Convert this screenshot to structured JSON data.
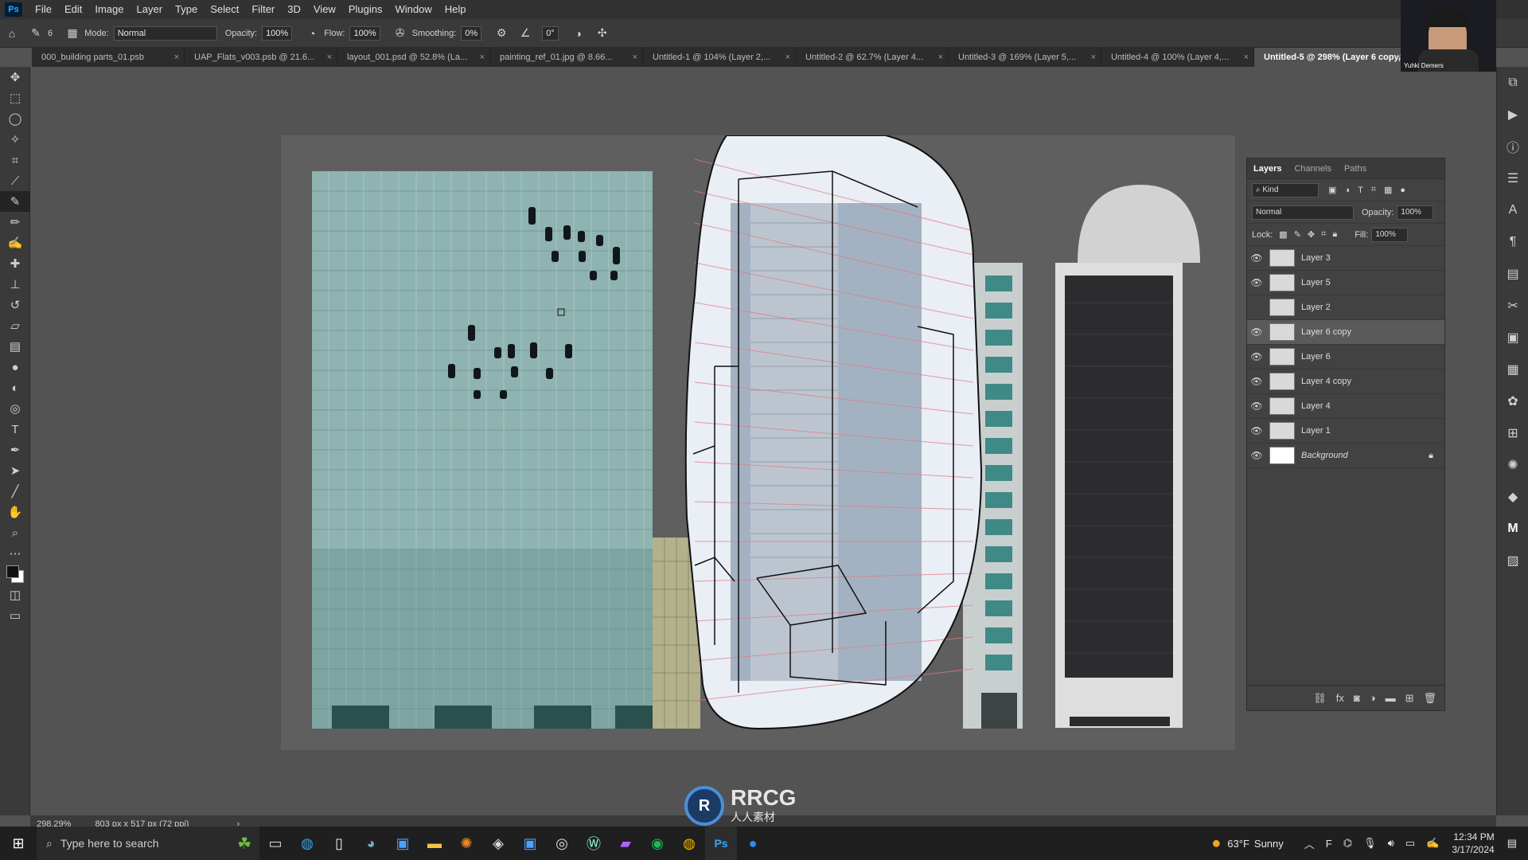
{
  "menubar": {
    "logo": "Ps",
    "items": [
      "File",
      "Edit",
      "Image",
      "Layer",
      "Type",
      "Select",
      "Filter",
      "3D",
      "View",
      "Plugins",
      "Window",
      "Help"
    ]
  },
  "options": {
    "brush_size": "6",
    "mode_label": "Mode:",
    "mode_value": "Normal",
    "opacity_label": "Opacity:",
    "opacity_value": "100%",
    "flow_label": "Flow:",
    "flow_value": "100%",
    "smoothing_label": "Smoothing:",
    "smoothing_value": "0%",
    "angle_value": "0°"
  },
  "tabs": [
    {
      "label": "000_building parts_01.psb"
    },
    {
      "label": "UAP_Flats_v003.psb @ 21.6..."
    },
    {
      "label": "layout_001.psd @ 52.8% (La..."
    },
    {
      "label": "painting_ref_01.jpg @ 8.66..."
    },
    {
      "label": "Untitled-1 @ 104% (Layer 2,..."
    },
    {
      "label": "Untitled-2 @ 62.7% (Layer 4..."
    },
    {
      "label": "Untitled-3 @ 169% (Layer 5,..."
    },
    {
      "label": "Untitled-4 @ 100% (Layer 4,..."
    },
    {
      "label": "Untitled-5 @ 298% (Layer 6 copy,"
    }
  ],
  "webcam": {
    "name": "Yuhki Demers"
  },
  "layers_panel": {
    "tabs": [
      "Layers",
      "Channels",
      "Paths"
    ],
    "kind_label": "Kind",
    "blend_mode": "Normal",
    "opacity_label": "Opacity:",
    "opacity_value": "100%",
    "lock_label": "Lock:",
    "fill_label": "Fill:",
    "fill_value": "100%",
    "layers": [
      {
        "name": "Layer 3",
        "visible": true
      },
      {
        "name": "Layer 5",
        "visible": true
      },
      {
        "name": "Layer 2",
        "visible": false
      },
      {
        "name": "Layer 6 copy",
        "visible": true,
        "selected": true
      },
      {
        "name": "Layer 6",
        "visible": true
      },
      {
        "name": "Layer 4 copy",
        "visible": true
      },
      {
        "name": "Layer 4",
        "visible": true
      },
      {
        "name": "Layer 1",
        "visible": true
      },
      {
        "name": "Background",
        "visible": true,
        "locked": true
      }
    ]
  },
  "status": {
    "zoom": "298.29%",
    "doc_info": "803 px x 517 px (72 ppi)"
  },
  "watermark": {
    "text": "RRCG",
    "subtext": "人人素材"
  },
  "taskbar": {
    "search_placeholder": "Type here to search",
    "weather_temp": "63°F",
    "weather_desc": "Sunny",
    "time": "12:34 PM",
    "date": "3/17/2024"
  }
}
